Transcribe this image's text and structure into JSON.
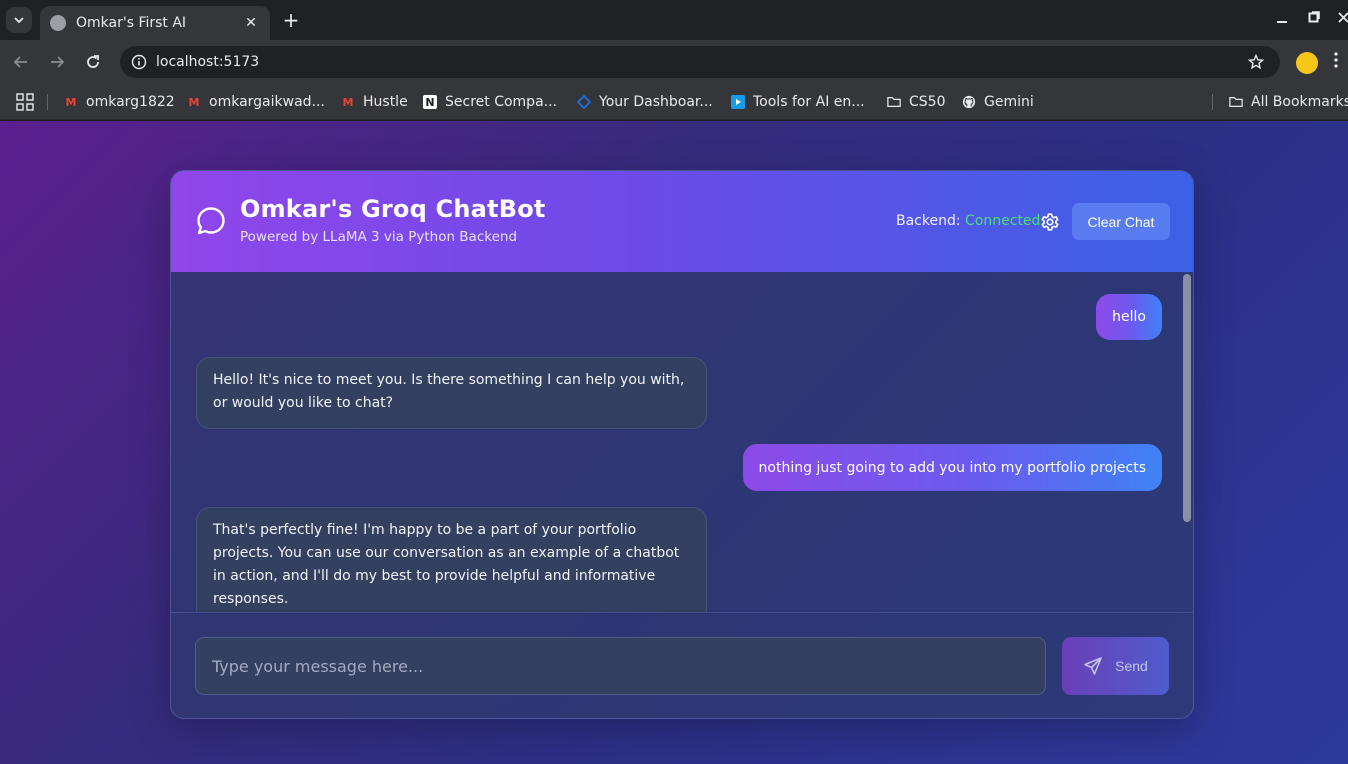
{
  "browser": {
    "tab_title": "Omkar's First AI",
    "url": "localhost:5173",
    "bookmarks": [
      {
        "label": "omkarg1822",
        "icon": "gmail-icon",
        "color": "#ea4335"
      },
      {
        "label": "omkargaikwad...",
        "icon": "gmail-icon",
        "color": "#ea4335"
      },
      {
        "label": "Hustle",
        "icon": "gmail-icon",
        "color": "#ea4335"
      },
      {
        "label": "Secret Compa...",
        "icon": "notion-icon",
        "color": "#ffffff"
      },
      {
        "label": "Your Dashboar...",
        "icon": "dashboard-icon",
        "color": "#1a73e8"
      },
      {
        "label": "Tools for AI en...",
        "icon": "play-icon",
        "color": "#1a9be6"
      },
      {
        "label": "CS50",
        "icon": "folder-icon",
        "color": "#e8eaed"
      },
      {
        "label": "Gemini",
        "icon": "github-icon",
        "color": "#e8eaed"
      }
    ],
    "all_bookmarks": "All Bookmarks"
  },
  "chat": {
    "title": "Omkar's Groq ChatBot",
    "subtitle": "Powered by LLaMA 3 via Python Backend",
    "backend_label": "Backend:",
    "backend_status": "Connected",
    "clear_label": "Clear Chat",
    "messages": [
      {
        "role": "user",
        "text": "hello"
      },
      {
        "role": "bot",
        "text": "Hello! It's nice to meet you. Is there something I can help you with, or would you like to chat?"
      },
      {
        "role": "user",
        "text": "nothing just going to add you into my portfolio projects"
      },
      {
        "role": "bot",
        "text": "That's perfectly fine! I'm happy to be a part of your portfolio projects. You can use our conversation as an example of a chatbot in action, and I'll do my best to provide helpful and informative responses."
      }
    ],
    "input_placeholder": "Type your message here...",
    "send_label": "Send"
  },
  "colors": {
    "status_connected": "#4ade80",
    "header_start": "#9046eb",
    "header_end": "#3a62e6"
  }
}
